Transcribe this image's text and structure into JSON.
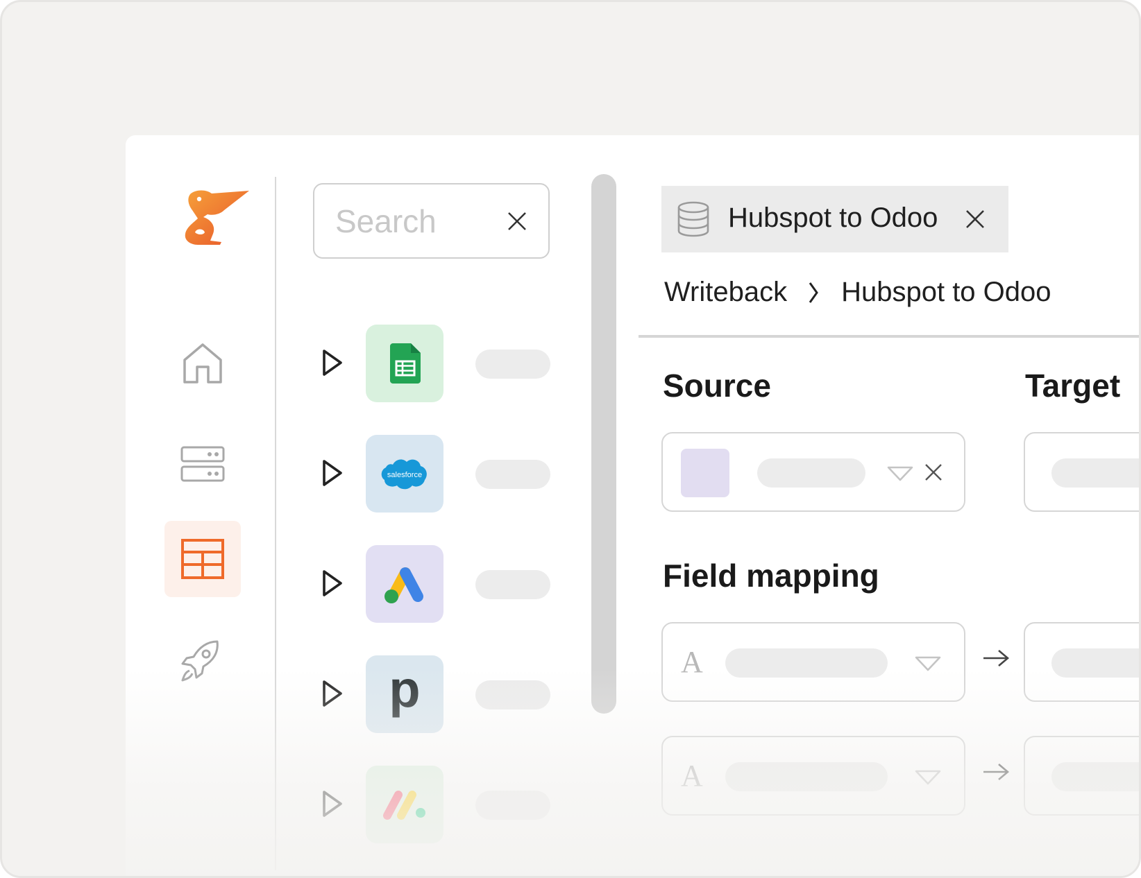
{
  "search": {
    "placeholder": "Search"
  },
  "nav": {
    "items": [
      {
        "id": "home",
        "icon": "home-icon",
        "active": false
      },
      {
        "id": "servers",
        "icon": "server-icon",
        "active": false
      },
      {
        "id": "tables",
        "icon": "table-icon",
        "active": true
      },
      {
        "id": "launch",
        "icon": "rocket-icon",
        "active": false
      }
    ]
  },
  "connectors": [
    {
      "icon": "google-sheets-icon",
      "tile_color": "#d9f1de"
    },
    {
      "icon": "salesforce-icon",
      "tile_color": "#d8e6f1",
      "logo_text": "salesforce"
    },
    {
      "icon": "google-ads-icon",
      "tile_color": "#e2dff3"
    },
    {
      "icon": "pipedrive-icon",
      "tile_color": "#dbe7ef",
      "logo_text": "p"
    },
    {
      "icon": "monday-icon",
      "tile_color": "#dff1e2"
    }
  ],
  "tab": {
    "label": "Hubspot to Odoo"
  },
  "breadcrumb": {
    "parent": "Writeback",
    "current": "Hubspot to Odoo"
  },
  "sections": {
    "source": "Source",
    "target": "Target",
    "field_mapping": "Field mapping"
  },
  "field_type_glyph": "A",
  "colors": {
    "accent": "#ef6a2a",
    "muted": "#ececec",
    "border": "#d6d6d6"
  }
}
